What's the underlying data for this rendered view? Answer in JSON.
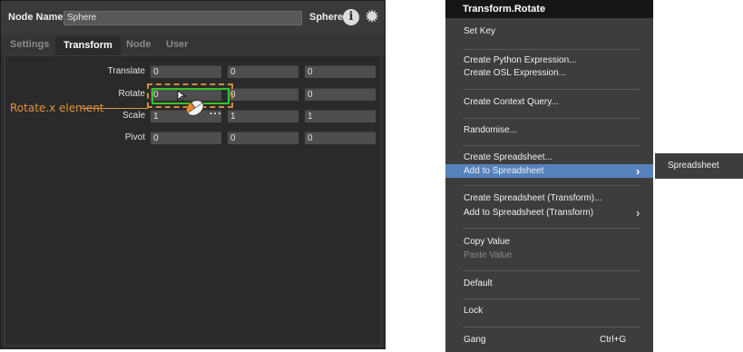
{
  "node": {
    "name_label": "Node Name",
    "name_value": "Sphere",
    "type_label": "Sphere",
    "info_icon": "info-icon",
    "settings_icon": "gear-icon"
  },
  "tabs": [
    {
      "label": "Settings",
      "active": false
    },
    {
      "label": "Transform",
      "active": true
    },
    {
      "label": "Node",
      "active": false
    },
    {
      "label": "User",
      "active": false
    }
  ],
  "transform": {
    "rows": [
      {
        "label": "Translate",
        "values": [
          "0",
          "0",
          "0"
        ]
      },
      {
        "label": "Rotate",
        "values": [
          "0",
          "0",
          "0"
        ]
      },
      {
        "label": "Scale",
        "values": [
          "1",
          "1",
          "1"
        ]
      },
      {
        "label": "Pivot",
        "values": [
          "0",
          "0",
          "0"
        ]
      }
    ]
  },
  "annotation": {
    "text": "Rotate.x element",
    "color": "#e1933c",
    "highlight_color": "#39c227"
  },
  "cursor_indicator": "···",
  "menu": {
    "title": "Transform.Rotate",
    "items": [
      {
        "label": "Set Key"
      },
      {
        "label": "Create Python Expression..."
      },
      {
        "label": "Create OSL Expression..."
      },
      {
        "label": "Create Context Query..."
      },
      {
        "label": "Randomise..."
      },
      {
        "label": "Create Spreadsheet..."
      },
      {
        "label": "Add to Spreadsheet",
        "highlighted": true,
        "submenu": true
      },
      {
        "label": "Create Spreadsheet (Transform)..."
      },
      {
        "label": "Add to Spreadsheet (Transform)",
        "submenu": true
      },
      {
        "label": "Copy Value"
      },
      {
        "label": "Paste Value",
        "disabled": true
      },
      {
        "label": "Default"
      },
      {
        "label": "Lock"
      },
      {
        "label": "Gang",
        "shortcut": "Ctrl+G"
      }
    ],
    "highlight_color": "#5682bb"
  },
  "submenu": {
    "items": [
      {
        "label": "Spreadsheet"
      }
    ]
  }
}
